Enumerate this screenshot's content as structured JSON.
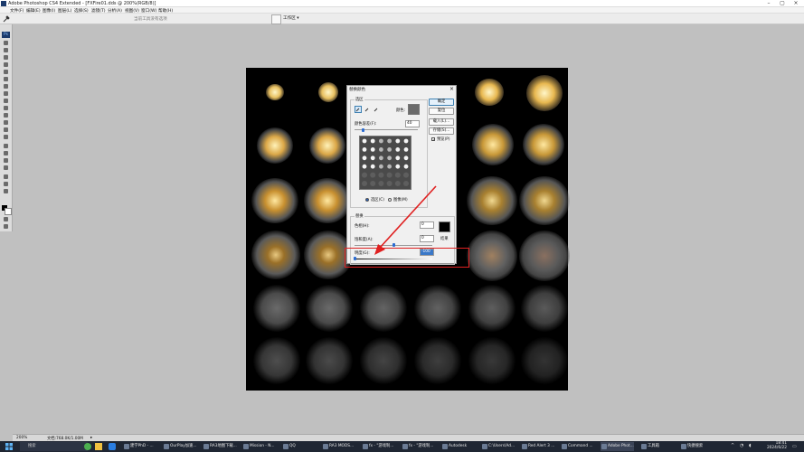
{
  "window": {
    "title": "Adobe Photoshop CS4 Extended - [FXFire01.dds @ 200%(RGB/8)]",
    "minimize": "–",
    "maximize": "▢",
    "close": "×"
  },
  "menu": [
    "文件(F)",
    "编辑(E)",
    "图像(I)",
    "图层(L)",
    "选择(S)",
    "滤镜(T)",
    "分析(A)",
    "视图(V)",
    "窗口(W)",
    "帮助(H)"
  ],
  "options_bar": {
    "tool_hint": "当前工具没有选项",
    "workspace_label": "工作区 ▾"
  },
  "tools_panel": {
    "logo": "Ps"
  },
  "dialog": {
    "title": "替换颜色",
    "close": "×",
    "selection_group": "选区",
    "color_label": "颜色:",
    "fuzziness_label": "颜色容差(F):",
    "fuzziness_value": "40",
    "fuzziness_level_pct": 14,
    "radio_selection": "选区(C)",
    "radio_image": "图像(M)",
    "replacement_group": "替换",
    "hue_label": "色相(H):",
    "hue_value": "0",
    "saturation_label": "饱和度(A):",
    "saturation_value": "0",
    "saturation_level_pct": 50,
    "lightness_label": "明度(G):",
    "lightness_value": "-100",
    "lightness_level_pct": 0,
    "result_label": "结果",
    "buttons": {
      "ok": "确定",
      "cancel": "复位",
      "load": "载入(L)...",
      "save": "存储(S)...",
      "preview": "预览(P)"
    },
    "colors": {
      "sample": "#6b6b6b",
      "result": "#000000"
    }
  },
  "status_bar": {
    "zoom": "200%",
    "doc_info": "文档:768.0K/1.00M"
  },
  "taskbar": {
    "search": "搜索",
    "items": [
      "建学PhD - ...",
      "OurPlay加速...",
      "RA3地图下载...",
      "Mission - N...",
      "QQ",
      "RA3 MODS...",
      "fx - \"游戏制...",
      "fx - \"游戏制...",
      "Autodesk",
      "C:\\Users\\Ad...",
      "Red Alert 3 ...",
      "Command ...",
      "Adobe Phot...",
      "工具箱",
      "快捷搜索"
    ],
    "active_index": 12,
    "time": "18:41",
    "date": "2024/6/22"
  },
  "colors": {
    "accent_red": "#e02020",
    "photoshop_blue": "#1b3a6b"
  }
}
